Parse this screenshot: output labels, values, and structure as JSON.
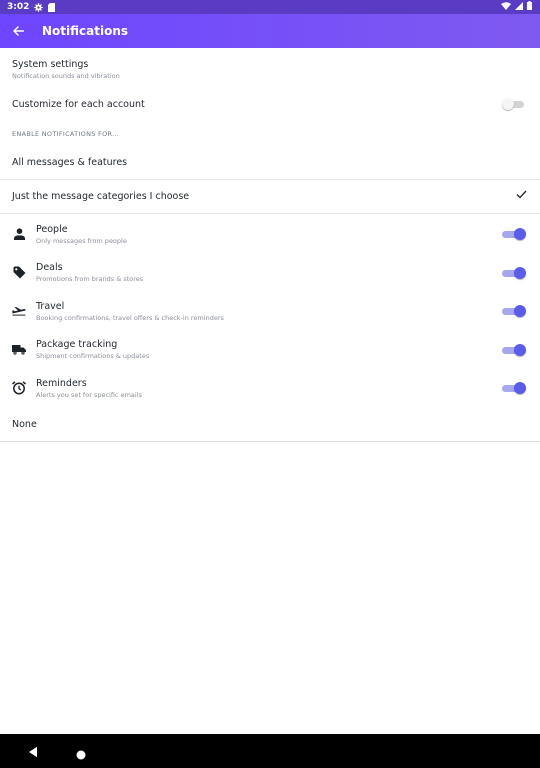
{
  "status_bar": {
    "time": "3:02"
  },
  "app_bar": {
    "title": "Notifications"
  },
  "system_settings": {
    "title": "System settings",
    "subtitle": "Notification sounds and vibration"
  },
  "customize": {
    "label": "Customize for each account",
    "enabled": false
  },
  "section_header": "ENABLE NOTIFICATIONS FOR...",
  "options": [
    {
      "label": "All messages & features",
      "selected": false
    },
    {
      "label": "Just the message categories I choose",
      "selected": true
    }
  ],
  "categories": [
    {
      "icon": "person-icon",
      "title": "People",
      "subtitle": "Only messages from people",
      "enabled": true
    },
    {
      "icon": "tag-icon",
      "title": "Deals",
      "subtitle": "Promotions from brands & stores",
      "enabled": true
    },
    {
      "icon": "airplane-icon",
      "title": "Travel",
      "subtitle": "Booking confirmations, travel offers & check-in reminders",
      "enabled": true
    },
    {
      "icon": "truck-icon",
      "title": "Package tracking",
      "subtitle": "Shipment confirmations & updates",
      "enabled": true
    },
    {
      "icon": "alarm-icon",
      "title": "Reminders",
      "subtitle": "Alerts you set for specific emails",
      "enabled": true
    }
  ],
  "none_option": {
    "label": "None"
  },
  "colors": {
    "accent": "#5b5ce8",
    "header": "#6d46ff",
    "status_bar": "#5a3bc4"
  }
}
